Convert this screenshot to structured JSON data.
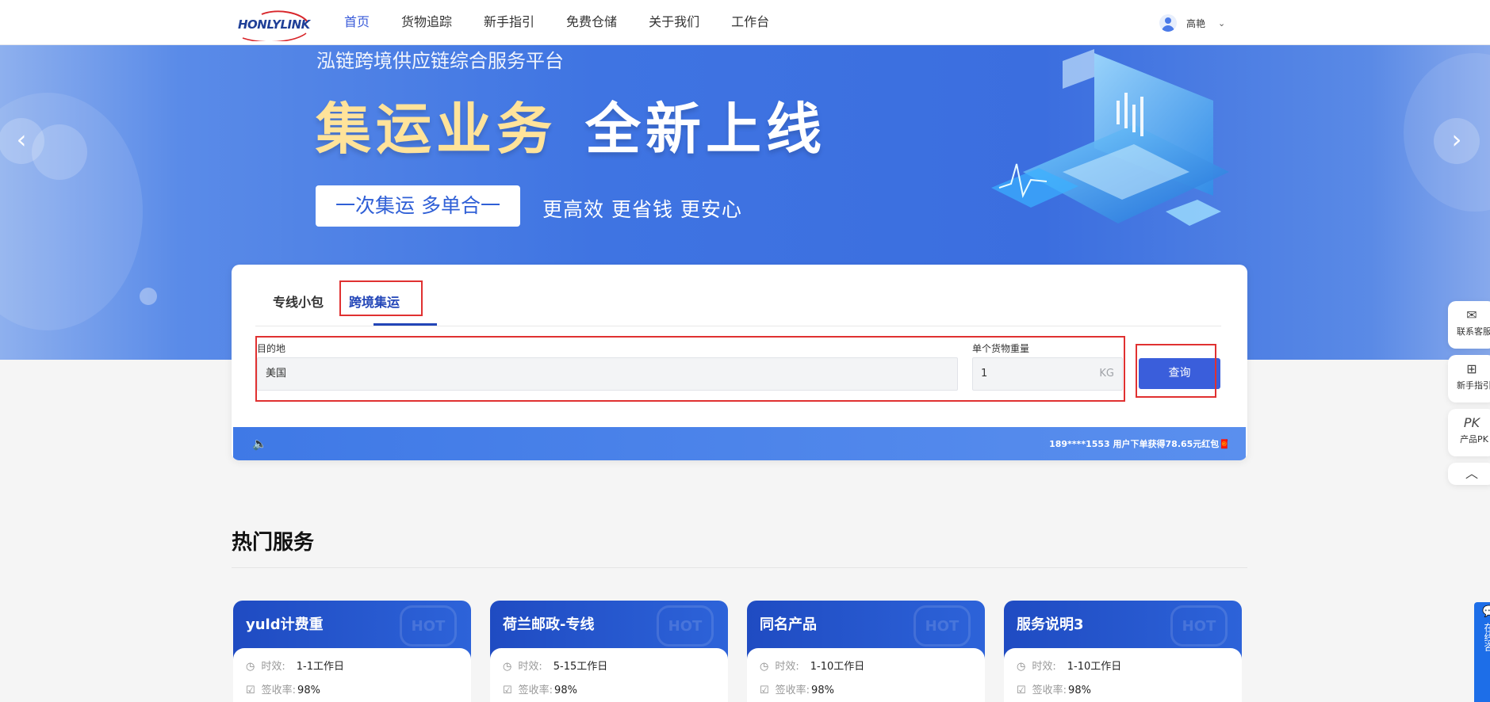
{
  "header": {
    "logo_text": "HONLYLINK",
    "nav": [
      "首页",
      "货物追踪",
      "新手指引",
      "免费仓储",
      "关于我们",
      "工作台"
    ],
    "user_name": "高艳"
  },
  "banner": {
    "subtitle": "泓链跨境供应链综合服务平台",
    "title_gold": "集运业务",
    "title_white": "全新上线",
    "pill": "一次集运  多单合一",
    "tagline": "更高效  更省钱  更安心"
  },
  "search": {
    "tabs": [
      "专线小包",
      "跨境集运"
    ],
    "destination_label": "目的地",
    "destination_value": "美国",
    "weight_label": "单个货物重量",
    "weight_value": "1",
    "weight_unit": "KG",
    "query_button": "查询",
    "notice": "189****1553 用户下单获得78.65元红包🧧"
  },
  "side_tools": [
    {
      "icon": "wechat-icon",
      "glyph": "✉",
      "label": "联系客服"
    },
    {
      "icon": "guide-icon",
      "glyph": "⊞",
      "label": "新手指引"
    },
    {
      "icon": "compare-icon",
      "glyph": "PK",
      "label": "产品PK"
    }
  ],
  "hot_services": {
    "title": "热门服务",
    "hot_badge": "HOT",
    "time_label": "时效:",
    "rate_label": "签收率:",
    "cards": [
      {
        "name": "yuld计费重",
        "time": "1-1工作日",
        "rate": "98%"
      },
      {
        "name": "荷兰邮政-专线",
        "time": "5-15工作日",
        "rate": "98%"
      },
      {
        "name": "同名产品",
        "time": "1-10工作日",
        "rate": "98%"
      },
      {
        "name": "服务说明3",
        "time": "1-10工作日",
        "rate": "98%"
      }
    ]
  },
  "float_chat": "在线咨",
  "colors": {
    "primary": "#3a5edb",
    "highlight": "#e03131",
    "banner": "#3f74e2"
  }
}
